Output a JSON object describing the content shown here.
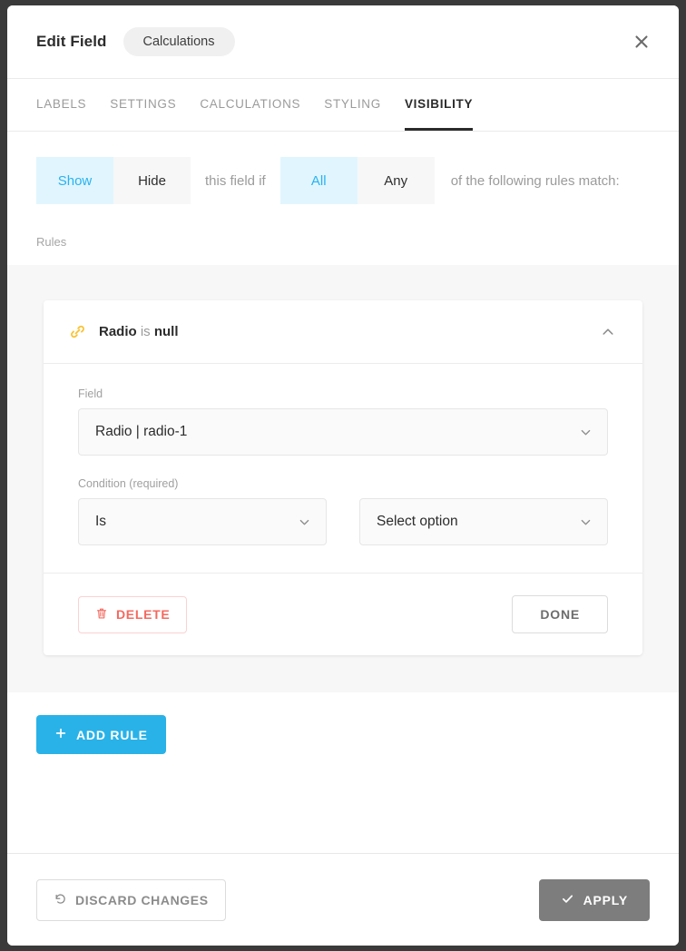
{
  "dialog": {
    "title": "Edit Field",
    "chip_label": "Calculations",
    "close_icon": "close-icon"
  },
  "tabs": [
    {
      "label": "LABELS",
      "active": false
    },
    {
      "label": "SETTINGS",
      "active": false
    },
    {
      "label": "CALCULATIONS",
      "active": false
    },
    {
      "label": "STYLING",
      "active": false
    },
    {
      "label": "VISIBILITY",
      "active": true
    }
  ],
  "visibility": {
    "visibility_toggle": {
      "options": [
        "Show",
        "Hide"
      ],
      "selected": "Show"
    },
    "middle_text": "this field if",
    "match_toggle": {
      "options": [
        "All",
        "Any"
      ],
      "selected": "All"
    },
    "trailing_text": "of the following rules match:",
    "rules_label": "Rules"
  },
  "rule": {
    "icon": "link-icon",
    "summary_field": "Radio",
    "summary_operator": "is",
    "summary_value": "null",
    "collapse_icon": "chevron-up-icon",
    "field_label": "Field",
    "field_value": "Radio | radio-1",
    "condition_label": "Condition (required)",
    "operator_value": "Is",
    "option_value": "Select option",
    "delete_label": "DELETE",
    "delete_icon": "trash-icon",
    "done_label": "DONE"
  },
  "actions": {
    "add_rule_label": "ADD RULE",
    "add_rule_icon": "plus-icon",
    "discard_label": "DISCARD CHANGES",
    "discard_icon": "undo-icon",
    "apply_label": "APPLY",
    "apply_icon": "check-icon"
  },
  "colors": {
    "accent_blue": "#29b2e8",
    "active_toggle_bg": "#e1f5fe",
    "active_toggle_text": "#29b2f0",
    "link_icon_yellow": "#fbc02d",
    "delete_red": "#f4695f",
    "apply_gray": "#7d7d7d",
    "section_bg": "#f7f7f7"
  }
}
